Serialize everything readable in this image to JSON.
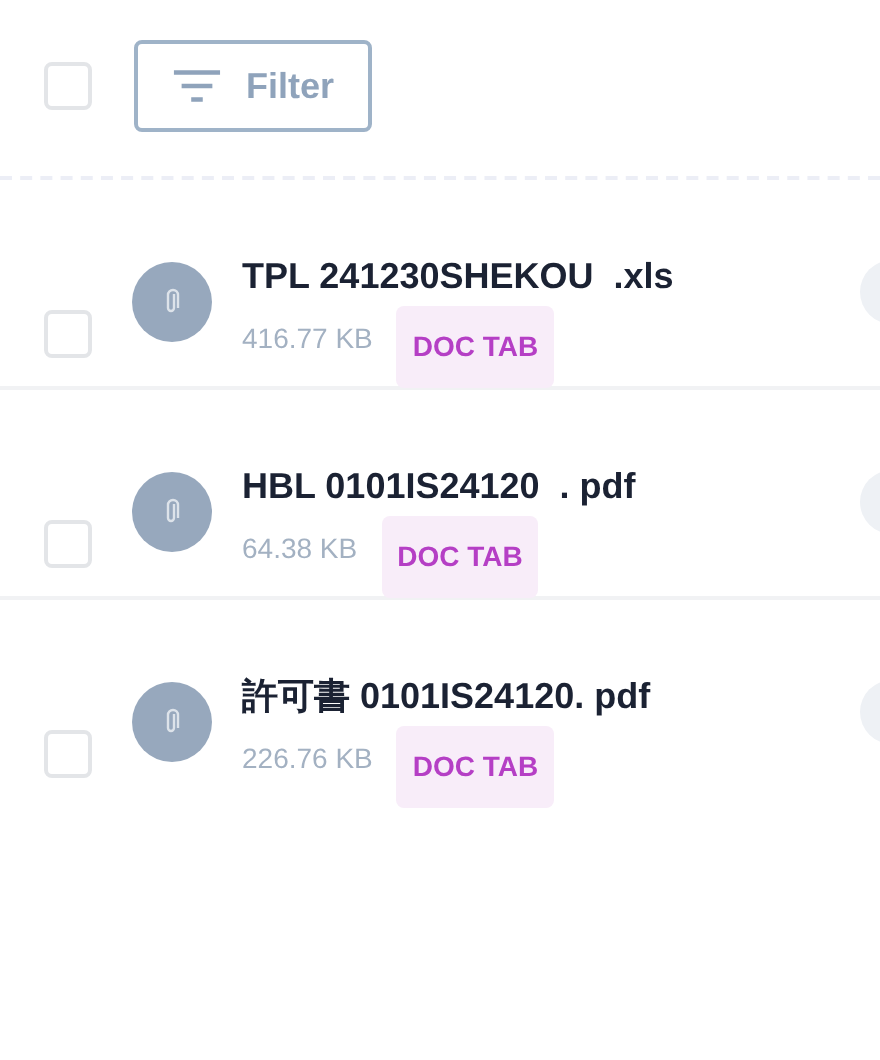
{
  "header": {
    "select_all": {
      "checked": false
    },
    "filter_button": "Filter"
  },
  "files": [
    {
      "name": "TPL 241230SHEKOU  .xls",
      "size": "416.77 KB",
      "tag": "DOC TAB",
      "checked": false
    },
    {
      "name": "HBL 0101IS24120  . pdf",
      "size": "64.38 KB",
      "tag": "DOC TAB",
      "checked": false
    },
    {
      "name": "許可書 0101IS24120. pdf",
      "size": "226.76 KB",
      "tag": "DOC TAB",
      "checked": false
    }
  ]
}
